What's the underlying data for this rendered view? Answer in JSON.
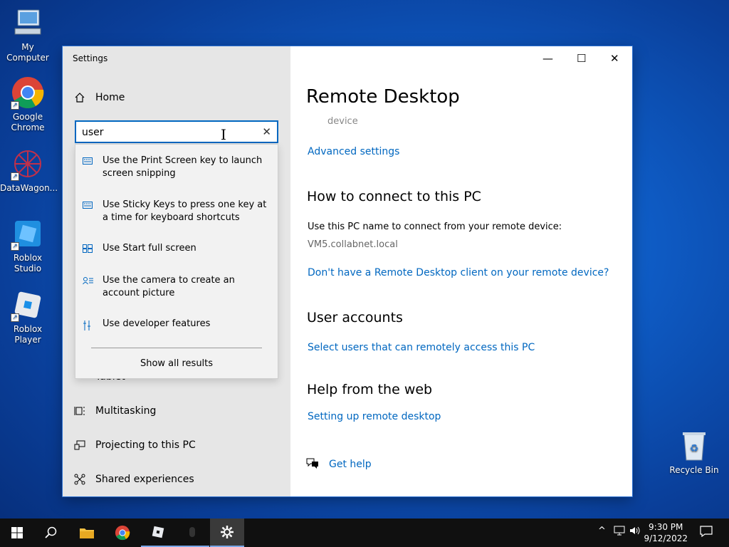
{
  "desktop": {
    "icons": [
      {
        "label": "My Computer"
      },
      {
        "label": "Google\nChrome"
      },
      {
        "label": "DataWagon..."
      },
      {
        "label": "Roblox Studio"
      },
      {
        "label": "Roblox Player"
      },
      {
        "label": "Recycle Bin"
      }
    ]
  },
  "window": {
    "title": "Settings",
    "home_label": "Home",
    "search": {
      "value": "user",
      "placeholder": ""
    },
    "suggestions": [
      {
        "icon": "keyboard-icon",
        "text": "Use the Print Screen key to launch screen snipping"
      },
      {
        "icon": "keyboard-icon",
        "text": "Use Sticky Keys to press one key at a time for keyboard shortcuts"
      },
      {
        "icon": "start-icon",
        "text": "Use Start full screen"
      },
      {
        "icon": "account-icon",
        "text": "Use the camera to create an account picture"
      },
      {
        "icon": "developer-icon",
        "text": "Use developer features"
      }
    ],
    "show_all": "Show all results",
    "nav_partial": "Tablet",
    "nav": [
      {
        "icon": "multitasking-icon",
        "label": "Multitasking"
      },
      {
        "icon": "projecting-icon",
        "label": "Projecting to this PC"
      },
      {
        "icon": "shared-experiences-icon",
        "label": "Shared experiences"
      }
    ],
    "controls": {
      "minimize": "—",
      "maximize": "☐",
      "close": "✕"
    }
  },
  "main": {
    "title": "Remote Desktop",
    "faded_text": "device",
    "advanced_link": "Advanced settings",
    "connect_heading": "How to connect to this PC",
    "connect_text": "Use this PC name to connect from your remote device:",
    "pc_name": "VM5.collabnet.local",
    "client_link": "Don't have a Remote Desktop client on your remote device?",
    "accounts_heading": "User accounts",
    "accounts_link": "Select users that can remotely access this PC",
    "web_heading": "Help from the web",
    "web_link": "Setting up remote desktop",
    "help_link": "Get help"
  },
  "taskbar": {
    "time": "9:30 PM",
    "date": "9/12/2022"
  }
}
